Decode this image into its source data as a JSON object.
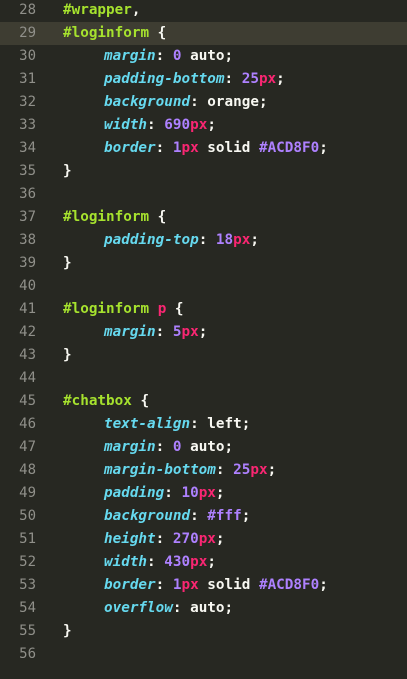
{
  "editor": {
    "language": "css",
    "theme": "monokai",
    "current_line": "29",
    "lines": [
      {
        "num": "28",
        "type": "selector",
        "selector": "#wrapper",
        "after": ","
      },
      {
        "num": "29",
        "type": "selector",
        "selector": "#loginform",
        "after": " {"
      },
      {
        "num": "30",
        "type": "decl",
        "prop": "margin",
        "v1": "0",
        "u1": "",
        "rest": " auto;"
      },
      {
        "num": "31",
        "type": "decl",
        "prop": "padding-bottom",
        "v1": "25",
        "u1": "px",
        "rest": ";"
      },
      {
        "num": "32",
        "type": "decl",
        "prop": "background",
        "v1": "",
        "u1": "",
        "rest": "orange;"
      },
      {
        "num": "33",
        "type": "decl",
        "prop": "width",
        "v1": "690",
        "u1": "px",
        "rest": ";"
      },
      {
        "num": "34",
        "type": "decl_border",
        "prop": "border",
        "v1": "1",
        "u1": "px",
        "mid": " solid ",
        "color": "#ACD8F0",
        "rest": ";"
      },
      {
        "num": "35",
        "type": "close",
        "text": "}"
      },
      {
        "num": "36",
        "type": "blank"
      },
      {
        "num": "37",
        "type": "selector",
        "selector": "#loginform",
        "after": " {"
      },
      {
        "num": "38",
        "type": "decl",
        "prop": "padding-top",
        "v1": "18",
        "u1": "px",
        "rest": ";"
      },
      {
        "num": "39",
        "type": "close",
        "text": "}"
      },
      {
        "num": "40",
        "type": "blank"
      },
      {
        "num": "41",
        "type": "selector_tag",
        "selector": "#loginform",
        "tag": "p",
        "after": " {"
      },
      {
        "num": "42",
        "type": "decl",
        "prop": "margin",
        "v1": "5",
        "u1": "px",
        "rest": ";"
      },
      {
        "num": "43",
        "type": "close",
        "text": "}"
      },
      {
        "num": "44",
        "type": "blank"
      },
      {
        "num": "45",
        "type": "selector",
        "selector": "#chatbox",
        "after": " {"
      },
      {
        "num": "46",
        "type": "decl",
        "prop": "text-align",
        "v1": "",
        "u1": "",
        "rest": "left;"
      },
      {
        "num": "47",
        "type": "decl",
        "prop": "margin",
        "v1": "0",
        "u1": "",
        "rest": " auto;"
      },
      {
        "num": "48",
        "type": "decl",
        "prop": "margin-bottom",
        "v1": "25",
        "u1": "px",
        "rest": ";"
      },
      {
        "num": "49",
        "type": "decl",
        "prop": "padding",
        "v1": "10",
        "u1": "px",
        "rest": ";"
      },
      {
        "num": "50",
        "type": "decl_color",
        "prop": "background",
        "color": "#fff",
        "rest": ";"
      },
      {
        "num": "51",
        "type": "decl",
        "prop": "height",
        "v1": "270",
        "u1": "px",
        "rest": ";"
      },
      {
        "num": "52",
        "type": "decl",
        "prop": "width",
        "v1": "430",
        "u1": "px",
        "rest": ";"
      },
      {
        "num": "53",
        "type": "decl_border",
        "prop": "border",
        "v1": "1",
        "u1": "px",
        "mid": " solid ",
        "color": "#ACD8F0",
        "rest": ";"
      },
      {
        "num": "54",
        "type": "decl",
        "prop": "overflow",
        "v1": "",
        "u1": "",
        "rest": "auto;"
      },
      {
        "num": "55",
        "type": "close",
        "text": "}"
      },
      {
        "num": "56",
        "type": "blank"
      }
    ]
  }
}
